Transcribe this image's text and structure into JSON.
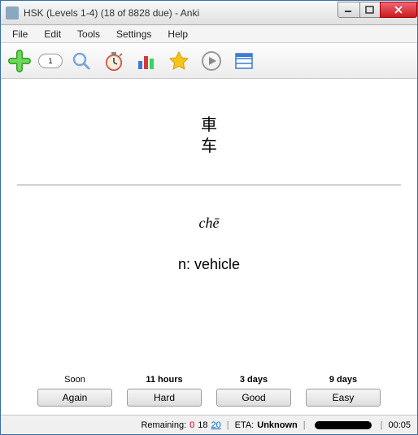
{
  "window": {
    "title": "HSK (Levels 1-4) (18 of 8828 due) - Anki"
  },
  "menu": {
    "file": "File",
    "edit": "Edit",
    "tools": "Tools",
    "settings": "Settings",
    "help": "Help"
  },
  "toolbar": {
    "counter": "1"
  },
  "card": {
    "hanzi1": "車",
    "hanzi2": "车",
    "pinyin": "chē",
    "meaning": "n: vehicle"
  },
  "answers": {
    "again": {
      "interval": "Soon",
      "label": "Again"
    },
    "hard": {
      "interval": "11 hours",
      "label": "Hard"
    },
    "good": {
      "interval": "3 days",
      "label": "Good"
    },
    "easy": {
      "interval": "9 days",
      "label": "Easy"
    }
  },
  "status": {
    "remaining_label": "Remaining:",
    "remaining_new": "0",
    "remaining_learn": "18",
    "remaining_review": "20",
    "eta_label": "ETA:",
    "eta_value": "Unknown",
    "timer": "00:05"
  }
}
